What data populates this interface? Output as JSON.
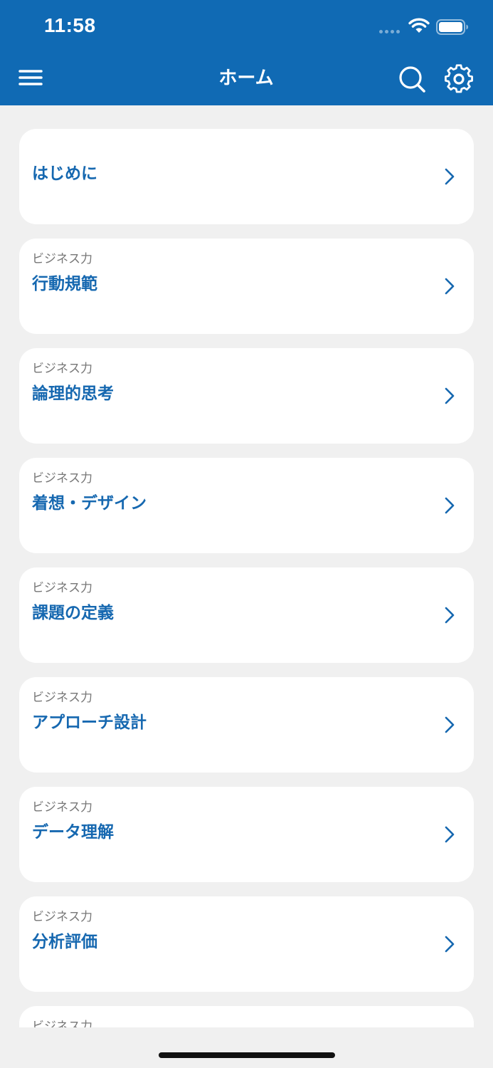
{
  "status_bar": {
    "time": "11:58"
  },
  "nav": {
    "title": "ホーム"
  },
  "colors": {
    "header": "#106ab4",
    "title_text": "#1668b0",
    "category_text": "#777777",
    "background": "#f0f0f0"
  },
  "icons": {
    "menu": "menu-icon",
    "search": "search-icon",
    "settings": "gear-icon",
    "chevron": "chevron-right-icon"
  },
  "items": [
    {
      "category": "",
      "title": "はじめに"
    },
    {
      "category": "ビジネス力",
      "title": "行動規範"
    },
    {
      "category": "ビジネス力",
      "title": "論理的思考"
    },
    {
      "category": "ビジネス力",
      "title": "着想・デザイン"
    },
    {
      "category": "ビジネス力",
      "title": "課題の定義"
    },
    {
      "category": "ビジネス力",
      "title": "アプローチ設計"
    },
    {
      "category": "ビジネス力",
      "title": "データ理解"
    },
    {
      "category": "ビジネス力",
      "title": "分析評価"
    },
    {
      "category": "ビジネス力",
      "title": ""
    }
  ]
}
